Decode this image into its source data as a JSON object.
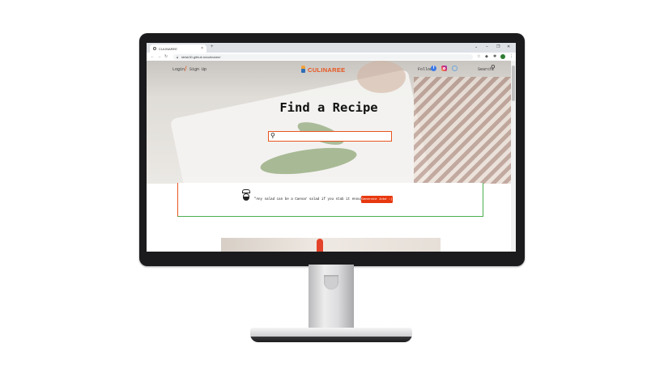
{
  "browser": {
    "tab_title": "CULINAREE",
    "tab_close": "×",
    "new_tab": "+",
    "url": "idrisk30.github.io/culinaree/",
    "window_controls": [
      "⌄",
      "–",
      "❐",
      "✕"
    ]
  },
  "site": {
    "login": "Login",
    "signup": "Sign Up",
    "brand": "CULINAREE",
    "follow_label": "Follow",
    "facebook_glyph": "f",
    "search_label": "Search"
  },
  "hero": {
    "title": "Find a Recipe",
    "search_placeholder": ""
  },
  "joke": {
    "text": "\"Any salad can be a Caesar salad if you stab it enough.\"",
    "button_label": "Generate Joke :)"
  },
  "colors": {
    "accent": "#e8551f",
    "button": "#e8380f",
    "green_border": "#4caf50"
  },
  "icons": {
    "search": "search-icon",
    "facebook": "facebook-icon",
    "instagram": "instagram-icon",
    "pinterest": "pinterest-icon",
    "chef": "chef-icon"
  }
}
